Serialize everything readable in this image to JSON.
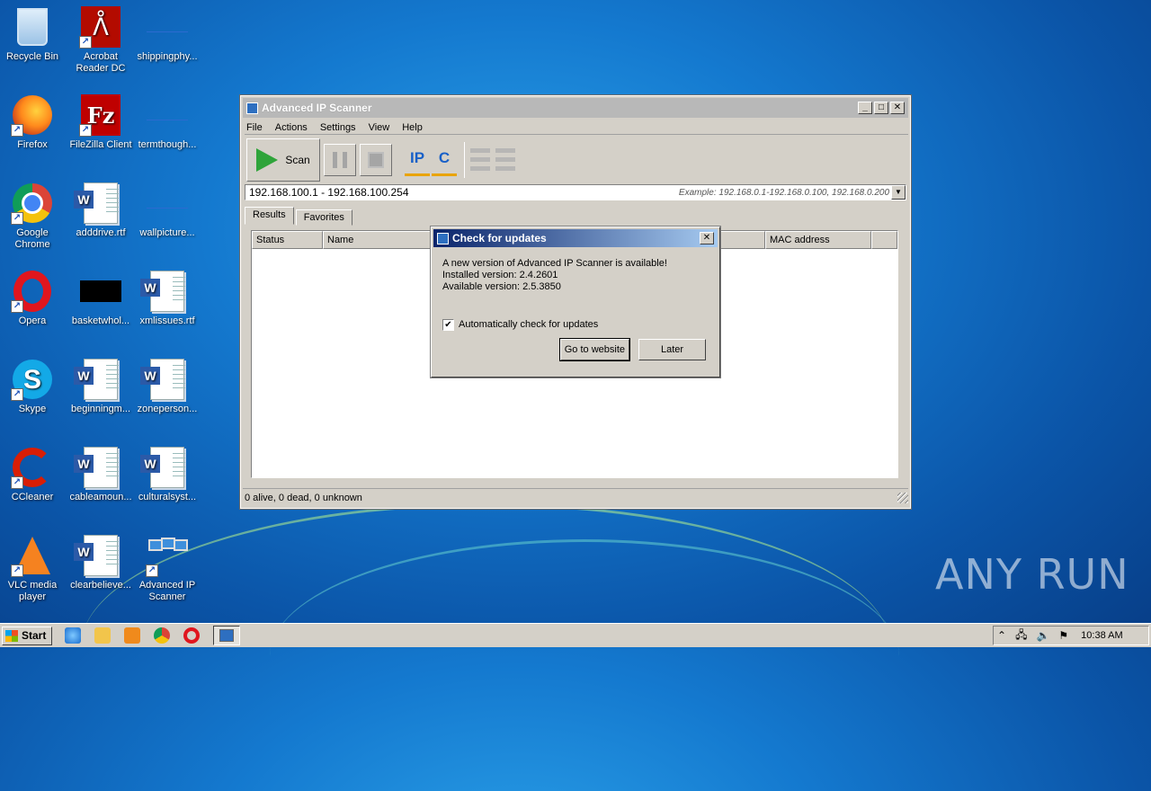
{
  "desktop": {
    "icons": [
      {
        "label": "Recycle Bin"
      },
      {
        "label": "Acrobat Reader DC"
      },
      {
        "label": "shippingphy..."
      },
      {
        "label": "Firefox"
      },
      {
        "label": "FileZilla Client"
      },
      {
        "label": "termthough..."
      },
      {
        "label": "Google Chrome"
      },
      {
        "label": "adddrive.rtf"
      },
      {
        "label": "wallpicture..."
      },
      {
        "label": "Opera"
      },
      {
        "label": "basketwhol..."
      },
      {
        "label": "xmlissues.rtf"
      },
      {
        "label": "Skype"
      },
      {
        "label": "beginningm..."
      },
      {
        "label": "zoneperson..."
      },
      {
        "label": "CCleaner"
      },
      {
        "label": "cableamoun..."
      },
      {
        "label": "culturalsyst..."
      },
      {
        "label": "VLC media player"
      },
      {
        "label": "clearbelieve..."
      },
      {
        "label": "Advanced IP Scanner"
      }
    ]
  },
  "window": {
    "title": "Advanced IP Scanner",
    "menu": [
      "File",
      "Actions",
      "Settings",
      "View",
      "Help"
    ],
    "toolbar": {
      "scan_label": "Scan",
      "ip_label": "IP",
      "c_label": "C"
    },
    "range": {
      "value": "192.168.100.1 - 192.168.100.254",
      "example": "Example: 192.168.0.1-192.168.0.100, 192.168.0.200"
    },
    "tabs": [
      "Results",
      "Favorites"
    ],
    "columns": [
      "Status",
      "Name",
      "MAC address"
    ],
    "status": "0 alive, 0 dead, 0 unknown"
  },
  "dialog": {
    "title": "Check for updates",
    "message": "A new version of Advanced IP Scanner is available!",
    "installed": "Installed version: 2.4.2601",
    "available": "Available version: 2.5.3850",
    "auto_check_label": "Automatically check for updates",
    "auto_check": true,
    "go_button": "Go to website",
    "later_button": "Later"
  },
  "taskbar": {
    "start_label": "Start",
    "clock": "10:38 AM"
  },
  "watermark": "ANY RUN"
}
